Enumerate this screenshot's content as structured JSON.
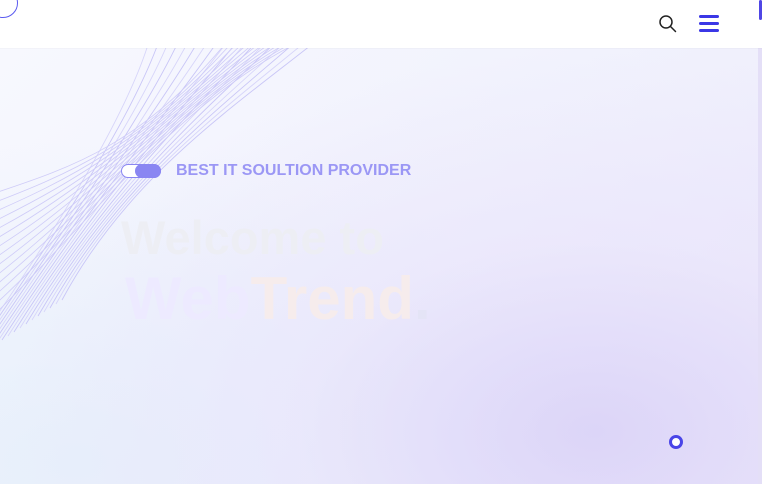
{
  "header": {
    "search_icon": "search-icon",
    "menu_icon": "hamburger-menu-icon",
    "accent_color": "#3b37e6"
  },
  "hero": {
    "tagline": "BEST IT SOULTION PROVIDER",
    "headline_line1": "Welcome to",
    "headline_part1": "Web",
    "headline_part2": "Trend",
    "headline_part3": ".",
    "tagline_color": "#9b97f5"
  },
  "widgets": {
    "toggle_icon": "toggle-switch-icon",
    "loader_icon": "circle-ring-icon"
  }
}
